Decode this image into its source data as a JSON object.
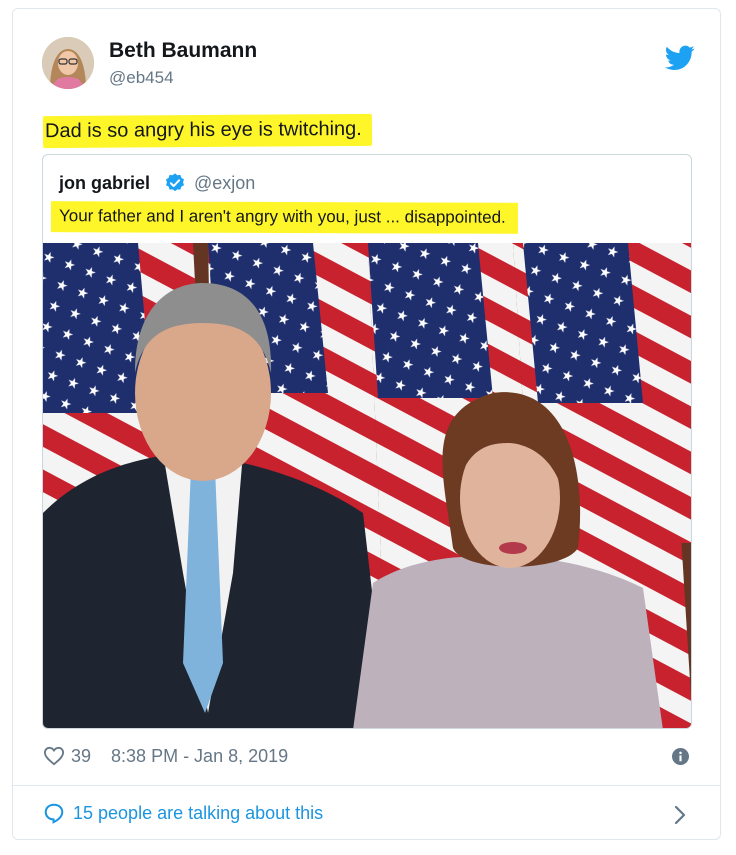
{
  "tweet": {
    "author_name": "Beth Baumann",
    "author_handle": "@eb454",
    "text": "Dad is so angry his eye is twitching."
  },
  "quoted_tweet": {
    "author_name": "jon gabriel",
    "author_handle": "@exjon",
    "text": "Your father and I aren't angry with you, just ... disappointed."
  },
  "footer": {
    "likes": "39",
    "timestamp": "8:38 PM - Jan 8, 2019",
    "conversation_label": "15 people are talking about this"
  },
  "icons": {
    "brand": "twitter-bird-icon",
    "verified": "verified-badge-icon",
    "like": "heart-icon",
    "info": "info-icon",
    "conversation": "speech-bubble-icon",
    "expand": "chevron-right-icon"
  },
  "colors": {
    "twitter_blue": "#1da1f2",
    "link_blue": "#1b95e0",
    "highlight_yellow": "#fff62a",
    "secondary_text": "#657786"
  }
}
